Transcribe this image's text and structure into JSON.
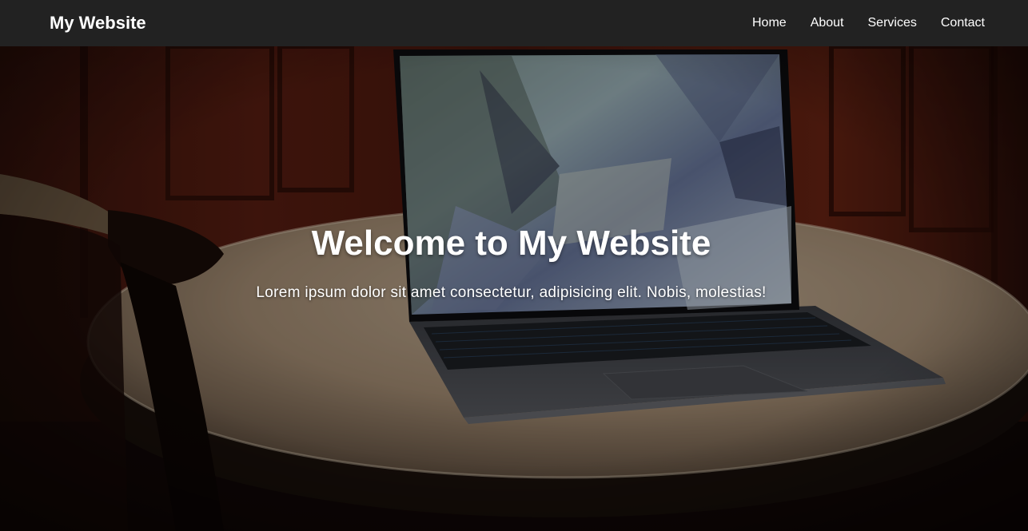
{
  "nav": {
    "brand": "My Website",
    "links": [
      "Home",
      "About",
      "Services",
      "Contact"
    ]
  },
  "hero": {
    "title": "Welcome to My Website",
    "subtitle": "Lorem ipsum dolor sit amet consectetur, adipisicing elit. Nobis, molestias!"
  },
  "colors": {
    "navbar_bg": "#222222",
    "text": "#ffffff"
  }
}
